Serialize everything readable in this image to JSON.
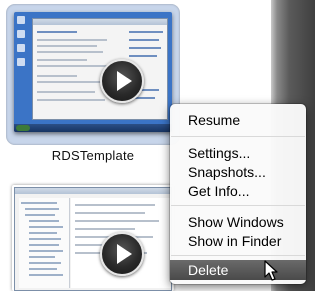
{
  "vm": {
    "name": "RDSTemplate"
  },
  "context_menu": {
    "groups": [
      [
        "Resume"
      ],
      [
        "Settings...",
        "Snapshots...",
        "Get Info..."
      ],
      [
        "Show Windows",
        "Show in Finder"
      ],
      [
        "Delete"
      ]
    ],
    "highlighted": "Delete"
  },
  "icons": {
    "play": "play-icon",
    "cursor": "mouse-pointer-icon"
  },
  "colors": {
    "selection": "#c7d5ea",
    "menu_highlight": "#555555",
    "desktop_blue": "#3b74c6"
  }
}
